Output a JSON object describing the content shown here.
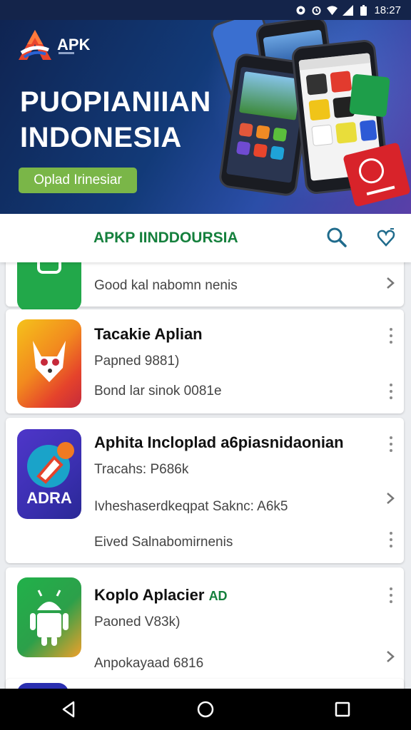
{
  "status_bar": {
    "time": "18:27",
    "icons": [
      "record-icon",
      "alarm-icon",
      "wifi-icon",
      "signal-icon",
      "battery-icon"
    ]
  },
  "banner": {
    "logo_text": "APK",
    "title_line1": "PUOPIANIIAN",
    "title_line2": "INDONESIA",
    "button_label": "Oplad Irinesiar",
    "accent_color": "#7ab648"
  },
  "app_bar": {
    "title": "APKP IINDDOURSIA",
    "title_color": "#15803d",
    "actions": [
      "search-icon",
      "favorite-icon"
    ]
  },
  "cards": [
    {
      "line1": "Good kal nabomn nenis"
    },
    {
      "title": "Tacakie Aplian",
      "line1": "Papned 9881)",
      "line2": "Bond lar sinok 0081e"
    },
    {
      "title": "Aphita Incloplad a6piasnidaonian",
      "line1": "Tracahs: P686k",
      "line2": "Ivheshaserdkeqpat Saknc: A6k5",
      "line3": "Eived Salnabomirnenis",
      "icon_label": "ADRA"
    },
    {
      "title": "Koplo Aplacier",
      "title_badge": "AD",
      "line1": "Paoned V83k)",
      "line2": "Anpokayaad 6816"
    }
  ],
  "nav_bar": {
    "buttons": [
      "back-icon",
      "home-icon",
      "recents-icon"
    ]
  }
}
